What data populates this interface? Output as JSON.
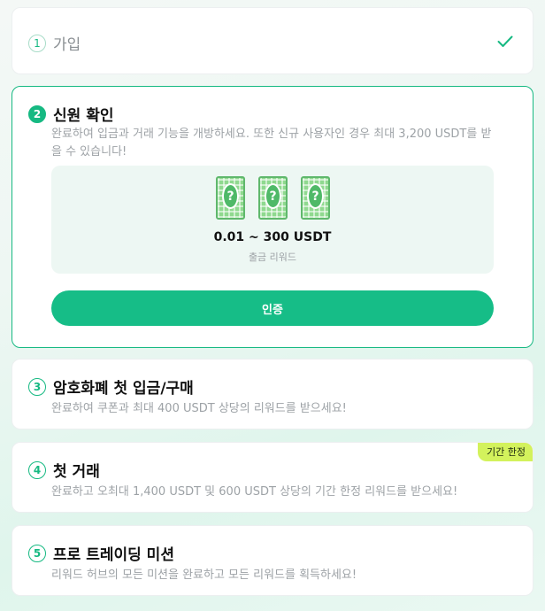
{
  "steps": [
    {
      "number": "1",
      "title": "가입",
      "status": "completed"
    },
    {
      "number": "2",
      "title": "신원 확인",
      "status": "active",
      "description": "완료하여 입금과 거래 기능을 개방하세요. 또한 신규 사용자인 경우 최대 3,200 USDT를 받을 수 있습니다!",
      "reward": {
        "card_symbol": "?",
        "amount": "0.01 ~ 300 USDT",
        "label": "출금 리워드"
      },
      "button_label": "인증"
    },
    {
      "number": "3",
      "title": "암호화폐 첫 입금/구매",
      "description": "완료하여 쿠폰과 최대 400 USDT 상당의 리워드를 받으세요!"
    },
    {
      "number": "4",
      "title": "첫 거래",
      "badge": "기간 한정",
      "description": "완료하고 오최대 1,400 USDT 및 600 USDT 상당의 기간 한정 리워드를 받으세요!"
    },
    {
      "number": "5",
      "title": "프로 트레이딩 미션",
      "description": "리워드 허브의 모든 미션을 완료하고 모든 리워드를 획득하세요!"
    }
  ],
  "colors": {
    "accent": "#16bd87",
    "badge": "#d3f25c",
    "muted_text": "#9da2a6"
  },
  "icons": {
    "completed": "checkmark-icon",
    "reward_card": "mystery-card-icon"
  }
}
